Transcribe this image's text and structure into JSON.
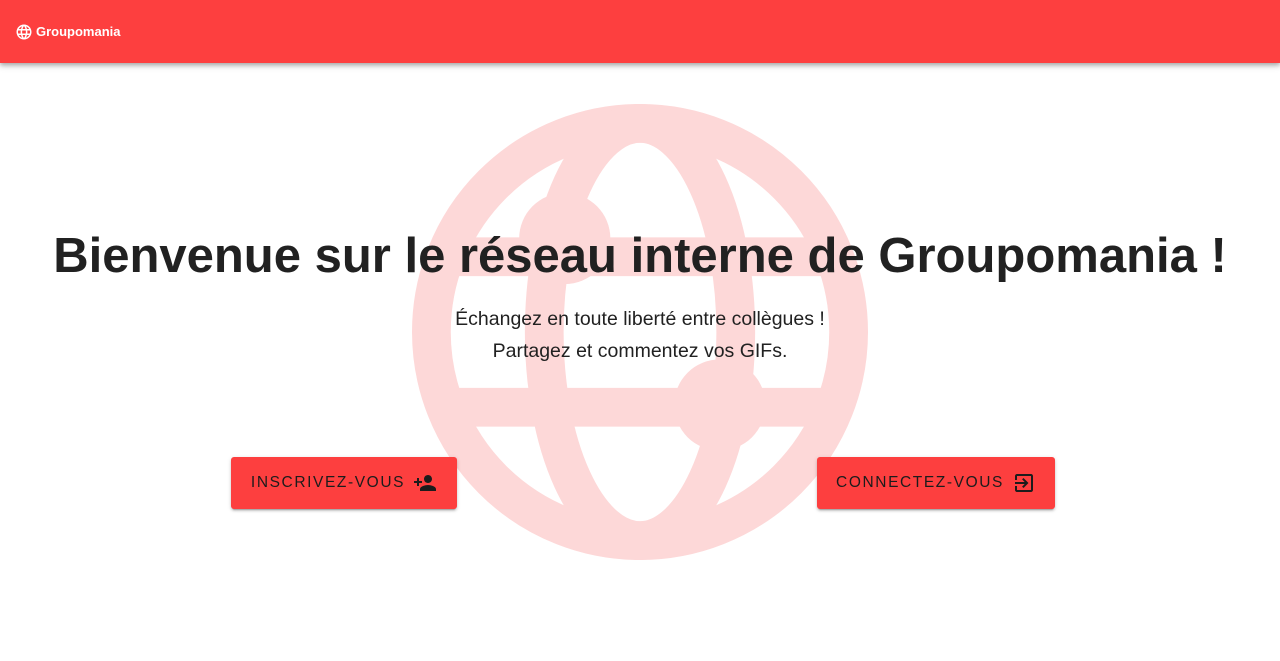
{
  "appbar": {
    "brand": "Groupomania",
    "brand_icon": "globe-icon",
    "color": "#fd3f3f"
  },
  "hero": {
    "title": "Bienvenue sur le réseau interne de Groupomania !",
    "subtitle_line1": "Échangez en toute liberté entre collègues !",
    "subtitle_line2": "Partagez et commentez vos GIFs.",
    "background_icon": "globe-icon",
    "background_icon_color": "#fdd8d8"
  },
  "actions": {
    "signup": {
      "label": "Inscrivez-vous",
      "icon": "person-add-icon"
    },
    "login": {
      "label": "Connectez-vous",
      "icon": "login-icon"
    },
    "button_color": "#fd3f3f"
  }
}
